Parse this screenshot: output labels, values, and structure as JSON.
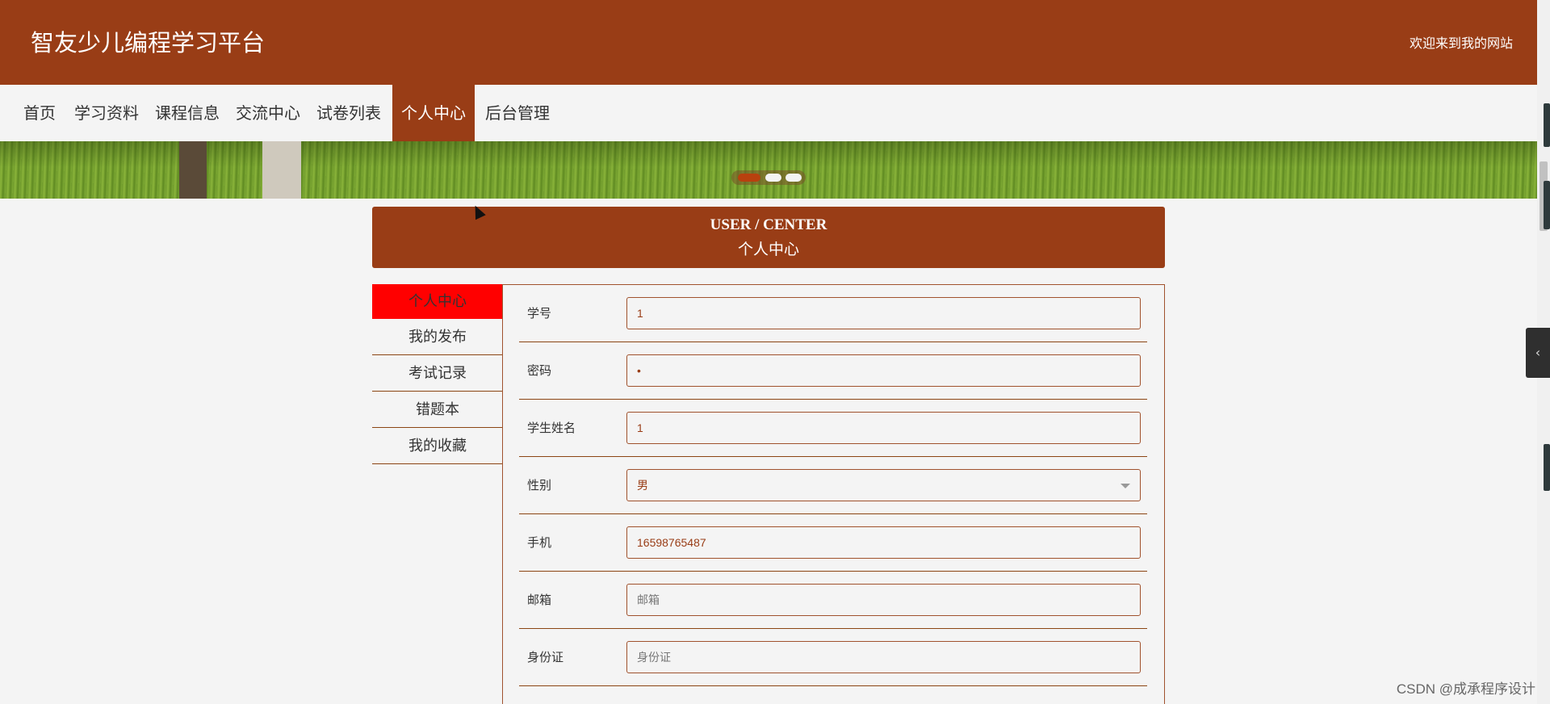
{
  "header": {
    "site_title": "智友少儿编程学习平台",
    "welcome": "欢迎来到我的网站"
  },
  "nav": {
    "items": [
      {
        "label": "首页"
      },
      {
        "label": "学习资料"
      },
      {
        "label": "课程信息"
      },
      {
        "label": "交流中心"
      },
      {
        "label": "试卷列表"
      },
      {
        "label": "个人中心",
        "active": true
      },
      {
        "label": "后台管理"
      }
    ]
  },
  "banner": {
    "slides": 3,
    "active_slide": 1
  },
  "user_center": {
    "title_en": "USER / CENTER",
    "title_cn": "个人中心"
  },
  "sidebar": {
    "items": [
      {
        "label": "个人中心",
        "active": true
      },
      {
        "label": "我的发布"
      },
      {
        "label": "考试记录"
      },
      {
        "label": "错题本"
      },
      {
        "label": "我的收藏"
      }
    ]
  },
  "form": {
    "fields": [
      {
        "label": "学号",
        "value": "1"
      },
      {
        "label": "密码",
        "value": "•"
      },
      {
        "label": "学生姓名",
        "value": "1"
      },
      {
        "label": "性别",
        "value": "男"
      },
      {
        "label": "手机",
        "value": "16598765487"
      },
      {
        "label": "邮箱",
        "placeholder": "邮箱"
      },
      {
        "label": "身份证",
        "placeholder": "身份证"
      }
    ]
  },
  "watermark": "CSDN @成承程序设计",
  "colors": {
    "brand": "#993d16",
    "active_side": "#ff0000",
    "background": "#f4f4f4"
  }
}
